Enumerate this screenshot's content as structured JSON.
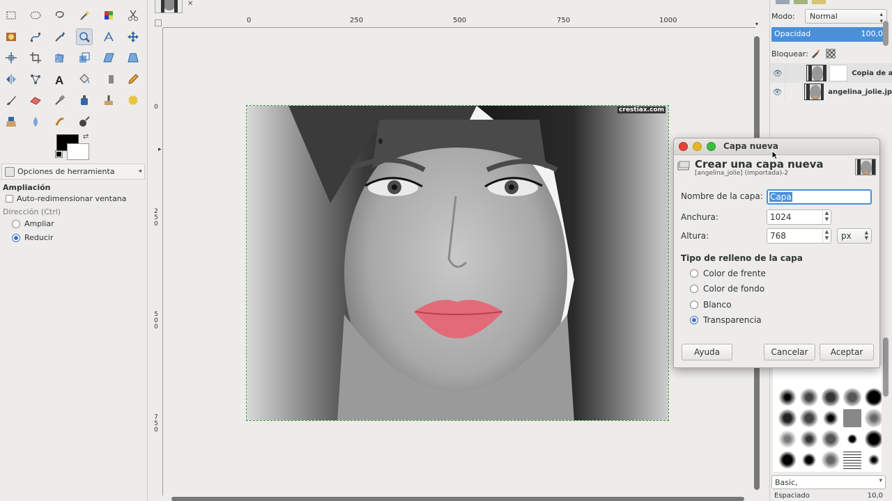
{
  "toolbox": {
    "tool_options_tab": "Opciones de herramienta",
    "tool_name": "Ampliación",
    "auto_resize_label": "Auto-redimensionar ventana",
    "direction_label": "Dirección  (Ctrl)",
    "direction_options": [
      "Ampliar",
      "Reducir"
    ],
    "direction_selected": "Reducir",
    "fg_color": "#000000",
    "bg_color": "#ffffff"
  },
  "canvas": {
    "ruler_top_labels": [
      "0",
      "250",
      "500",
      "750",
      "1000"
    ],
    "ruler_left_labels": [
      "0",
      "2\n5\n0",
      "5\n0\n0",
      "7\n5\n0"
    ],
    "watermark": "crestiax.com",
    "selection_color": "#3aa53a"
  },
  "dock": {
    "mode_label": "Modo:",
    "mode_value": "Normal",
    "opacity_label": "Opacidad",
    "opacity_value": "100,0",
    "lock_label": "Bloquear:",
    "layers": [
      {
        "name": "Copia de a",
        "selected": true
      },
      {
        "name": "angelina_jolie.jpg",
        "selected": false
      }
    ],
    "brush_set": "Basic,",
    "spacing_label": "Espaciado",
    "spacing_value": "10,0"
  },
  "dialog": {
    "title": "Capa nueva",
    "heading": "Crear una capa nueva",
    "subheading": "[angelina_jolie] (importada)-2",
    "name_label": "Nombre de la capa:",
    "name_value": "Capa",
    "width_label": "Anchura:",
    "width_value": "1024",
    "height_label": "Altura:",
    "height_value": "768",
    "unit_value": "px",
    "fill_heading": "Tipo de relleno de la capa",
    "fill_options": [
      "Color de frente",
      "Color de fondo",
      "Blanco",
      "Transparencia"
    ],
    "fill_selected": "Transparencia",
    "help_label": "Ayuda",
    "cancel_label": "Cancelar",
    "ok_label": "Aceptar"
  }
}
